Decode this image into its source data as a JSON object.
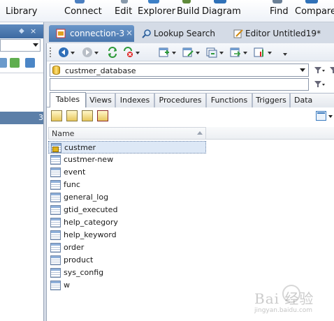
{
  "menu": {
    "items": [
      "Library",
      "Connect",
      "Edit",
      "Explorer",
      "Build",
      "Diagram",
      "Find",
      "Compare"
    ]
  },
  "doc_tabs": [
    {
      "label": "connection-3",
      "close": "×"
    },
    {
      "label": "Lookup Search"
    },
    {
      "label": "Editor Untitled19*"
    }
  ],
  "database": {
    "selected": "custmer_database"
  },
  "object_tabs": [
    "Tables",
    "Views",
    "Indexes",
    "Procedures",
    "Functions",
    "Triggers",
    "Data"
  ],
  "object_tabs_visible": [
    "Tables",
    "Views",
    "Indexes",
    "Procedures",
    "Functions",
    "Triggers",
    "Data"
  ],
  "grid": {
    "column": "Name",
    "rows": [
      "custmer",
      "custmer-new",
      "event",
      "func",
      "general_log",
      "gtid_executed",
      "help_category",
      "help_keyword",
      "order",
      "product",
      "sys_config",
      "w"
    ],
    "selected_row": "custmer"
  },
  "left_panel": {
    "selected_suffix": "3"
  },
  "watermark": {
    "text": "Bai 经验",
    "sub": "jingyan.baidu.com"
  },
  "colors": {
    "active_tab": "#4a77ae",
    "selection": "#dde8f6",
    "accent": "#3e6aa1"
  }
}
